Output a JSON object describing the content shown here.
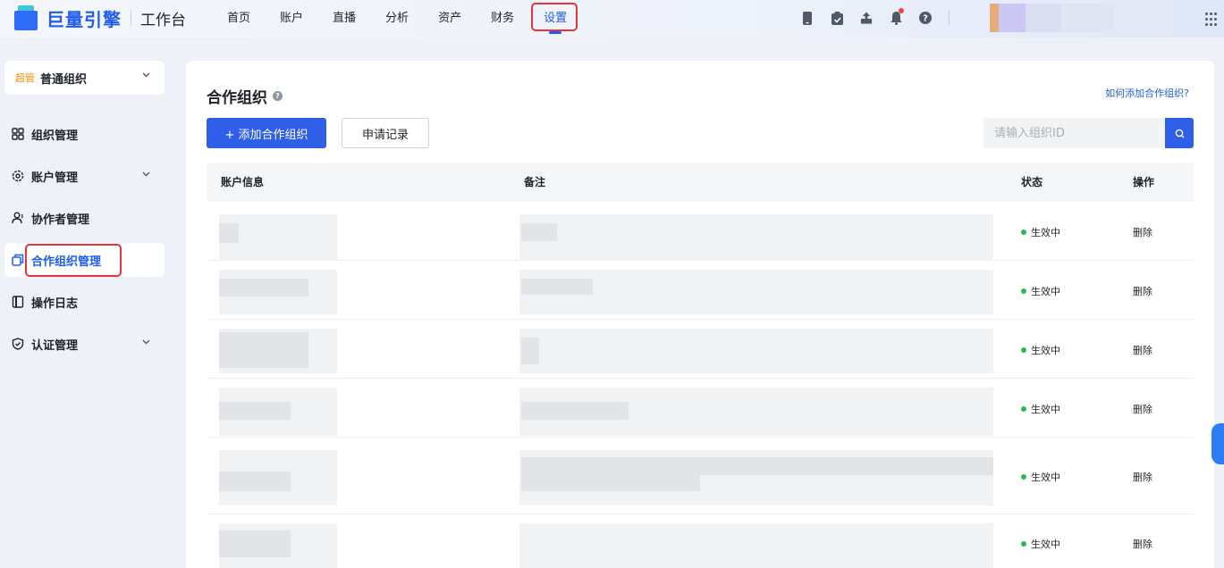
{
  "brand": {
    "name": "巨量引擎",
    "sub": "工作台"
  },
  "nav": {
    "items": [
      "首页",
      "账户",
      "直播",
      "分析",
      "资产",
      "财务",
      "设置"
    ],
    "active_index": 6
  },
  "topbar_icons": [
    "phone-icon",
    "clipboard-icon",
    "upload-icon",
    "bell-icon",
    "help-icon"
  ],
  "sidebar": {
    "org_tag": "超管",
    "org_name": "普通组织",
    "items": [
      {
        "label": "组织管理",
        "icon": "grid-icon",
        "has_arrow": false
      },
      {
        "label": "账户管理",
        "icon": "gear-icon",
        "has_arrow": true
      },
      {
        "label": "协作者管理",
        "icon": "users-icon",
        "has_arrow": false
      },
      {
        "label": "合作组织管理",
        "icon": "copy-icon",
        "has_arrow": false,
        "active": true
      },
      {
        "label": "操作日志",
        "icon": "log-icon",
        "has_arrow": false
      },
      {
        "label": "认证管理",
        "icon": "shield-icon",
        "has_arrow": true
      }
    ]
  },
  "page": {
    "title": "合作组织",
    "help_link": "如何添加合作组织?",
    "add_button": "+ 添加合作组织",
    "records_button": "申请记录",
    "search_placeholder": "请输入组织ID"
  },
  "table": {
    "columns": [
      "账户信息",
      "备注",
      "状态",
      "操作"
    ],
    "rows": [
      {
        "status": "生效中",
        "action": "删除"
      },
      {
        "status": "生效中",
        "action": "删除"
      },
      {
        "status": "生效中",
        "action": "删除"
      },
      {
        "status": "生效中",
        "action": "删除"
      },
      {
        "status": "生效中",
        "action": "删除"
      },
      {
        "status": "生效中",
        "action": "删除"
      }
    ]
  },
  "colors": {
    "accent": "#1e5cf0",
    "primary_button": "#2f5ee8",
    "highlight": "#e8323c",
    "status_ok": "#2bb84e"
  }
}
